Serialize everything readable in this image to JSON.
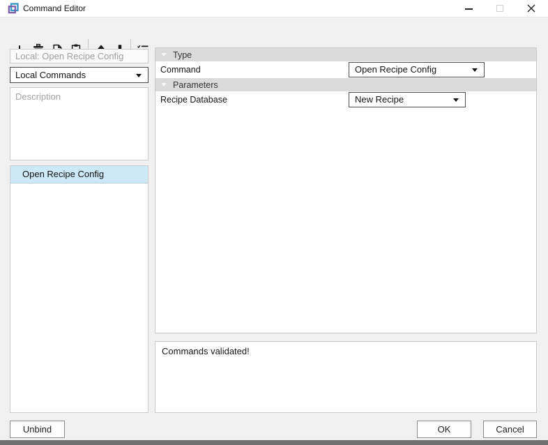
{
  "window": {
    "title": "Command Editor"
  },
  "toolbar": {
    "buttons": [
      {
        "name": "add",
        "icon": "plus-icon"
      },
      {
        "name": "delete",
        "icon": "trash-icon"
      },
      {
        "name": "copy",
        "icon": "copy-icon"
      },
      {
        "name": "paste",
        "icon": "paste-icon"
      },
      {
        "name": "move-up",
        "icon": "arrow-up-icon"
      },
      {
        "name": "move-down",
        "icon": "arrow-down-icon"
      },
      {
        "name": "validate",
        "icon": "checklist-icon"
      }
    ]
  },
  "left_panel": {
    "binding_field_value": "Local: Open Recipe Config",
    "scope_dropdown_value": "Local Commands",
    "description_placeholder": "Description",
    "command_list": [
      "Open Recipe Config"
    ]
  },
  "properties": {
    "type_section": {
      "title": "Type",
      "command_label": "Command",
      "command_value": "Open Recipe Config"
    },
    "parameters_section": {
      "title": "Parameters",
      "recipe_db_label": "Recipe Database",
      "recipe_db_value": "New Recipe"
    }
  },
  "validation_message": "Commands validated!",
  "footer": {
    "unbind_label": "Unbind",
    "ok_label": "OK",
    "cancel_label": "Cancel"
  },
  "colors": {
    "selection_bg": "#cde9f8",
    "section_header_bg": "#dadada",
    "titlebar_bg": "#ffffff",
    "window_bg": "#f0f0f0",
    "bottom_edge": "#6f6f6f",
    "logo_blue": "#3f96c8",
    "logo_purple": "#7a5ca8"
  }
}
